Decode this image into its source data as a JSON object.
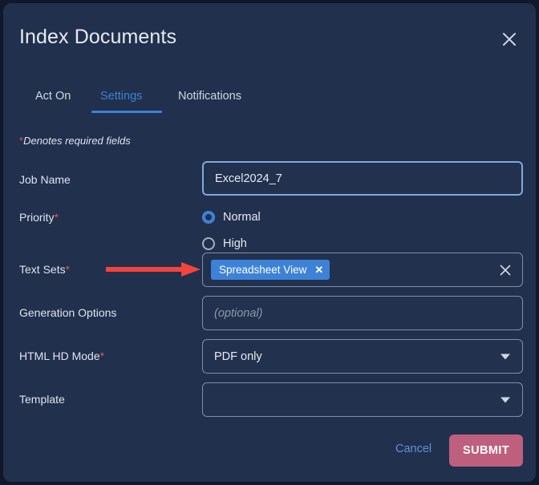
{
  "dialog": {
    "title": "Index Documents",
    "close_icon": "close-icon"
  },
  "tabs": [
    {
      "label": "Act On",
      "active": false
    },
    {
      "label": "Settings",
      "active": true
    },
    {
      "label": "Notifications",
      "active": false
    }
  ],
  "required_note": {
    "asterisk": "*",
    "text": "Denotes required fields"
  },
  "form": {
    "job_name": {
      "label": "Job Name",
      "required": false,
      "value": "Excel2024_7",
      "placeholder": "",
      "focused": true
    },
    "priority": {
      "label": "Priority",
      "required": true,
      "selected": "Normal",
      "options": [
        {
          "label": "Normal",
          "checked": true
        },
        {
          "label": "High",
          "checked": false
        }
      ]
    },
    "text_sets": {
      "label": "Text Sets",
      "required": true,
      "chips": [
        {
          "label": "Spreadsheet View",
          "remove_icon": "chip-close-icon"
        }
      ],
      "clear_icon": "clear-icon"
    },
    "generation_options": {
      "label": "Generation Options",
      "required": false,
      "value": "",
      "placeholder": "(optional)"
    },
    "html_hd_mode": {
      "label": "HTML HD Mode",
      "required": true,
      "value": "PDF only",
      "caret_icon": "chevron-down-icon"
    },
    "template": {
      "label": "Template",
      "required": false,
      "value": "",
      "caret_icon": "chevron-down-icon"
    }
  },
  "footer": {
    "cancel_label": "Cancel",
    "submit_label": "SUBMIT"
  },
  "annotation": {
    "arrow": "red-arrow-pointing-to-text-sets"
  },
  "colors": {
    "dialog_bg": "#21304d",
    "page_bg": "#12182b",
    "accent_blue": "#3d82d6",
    "required_red": "#e2574c",
    "submit_pink": "#bf5f7e",
    "field_border": "#7f8fa8",
    "focus_border": "#7eaade",
    "annotation_red": "#f4433c"
  }
}
